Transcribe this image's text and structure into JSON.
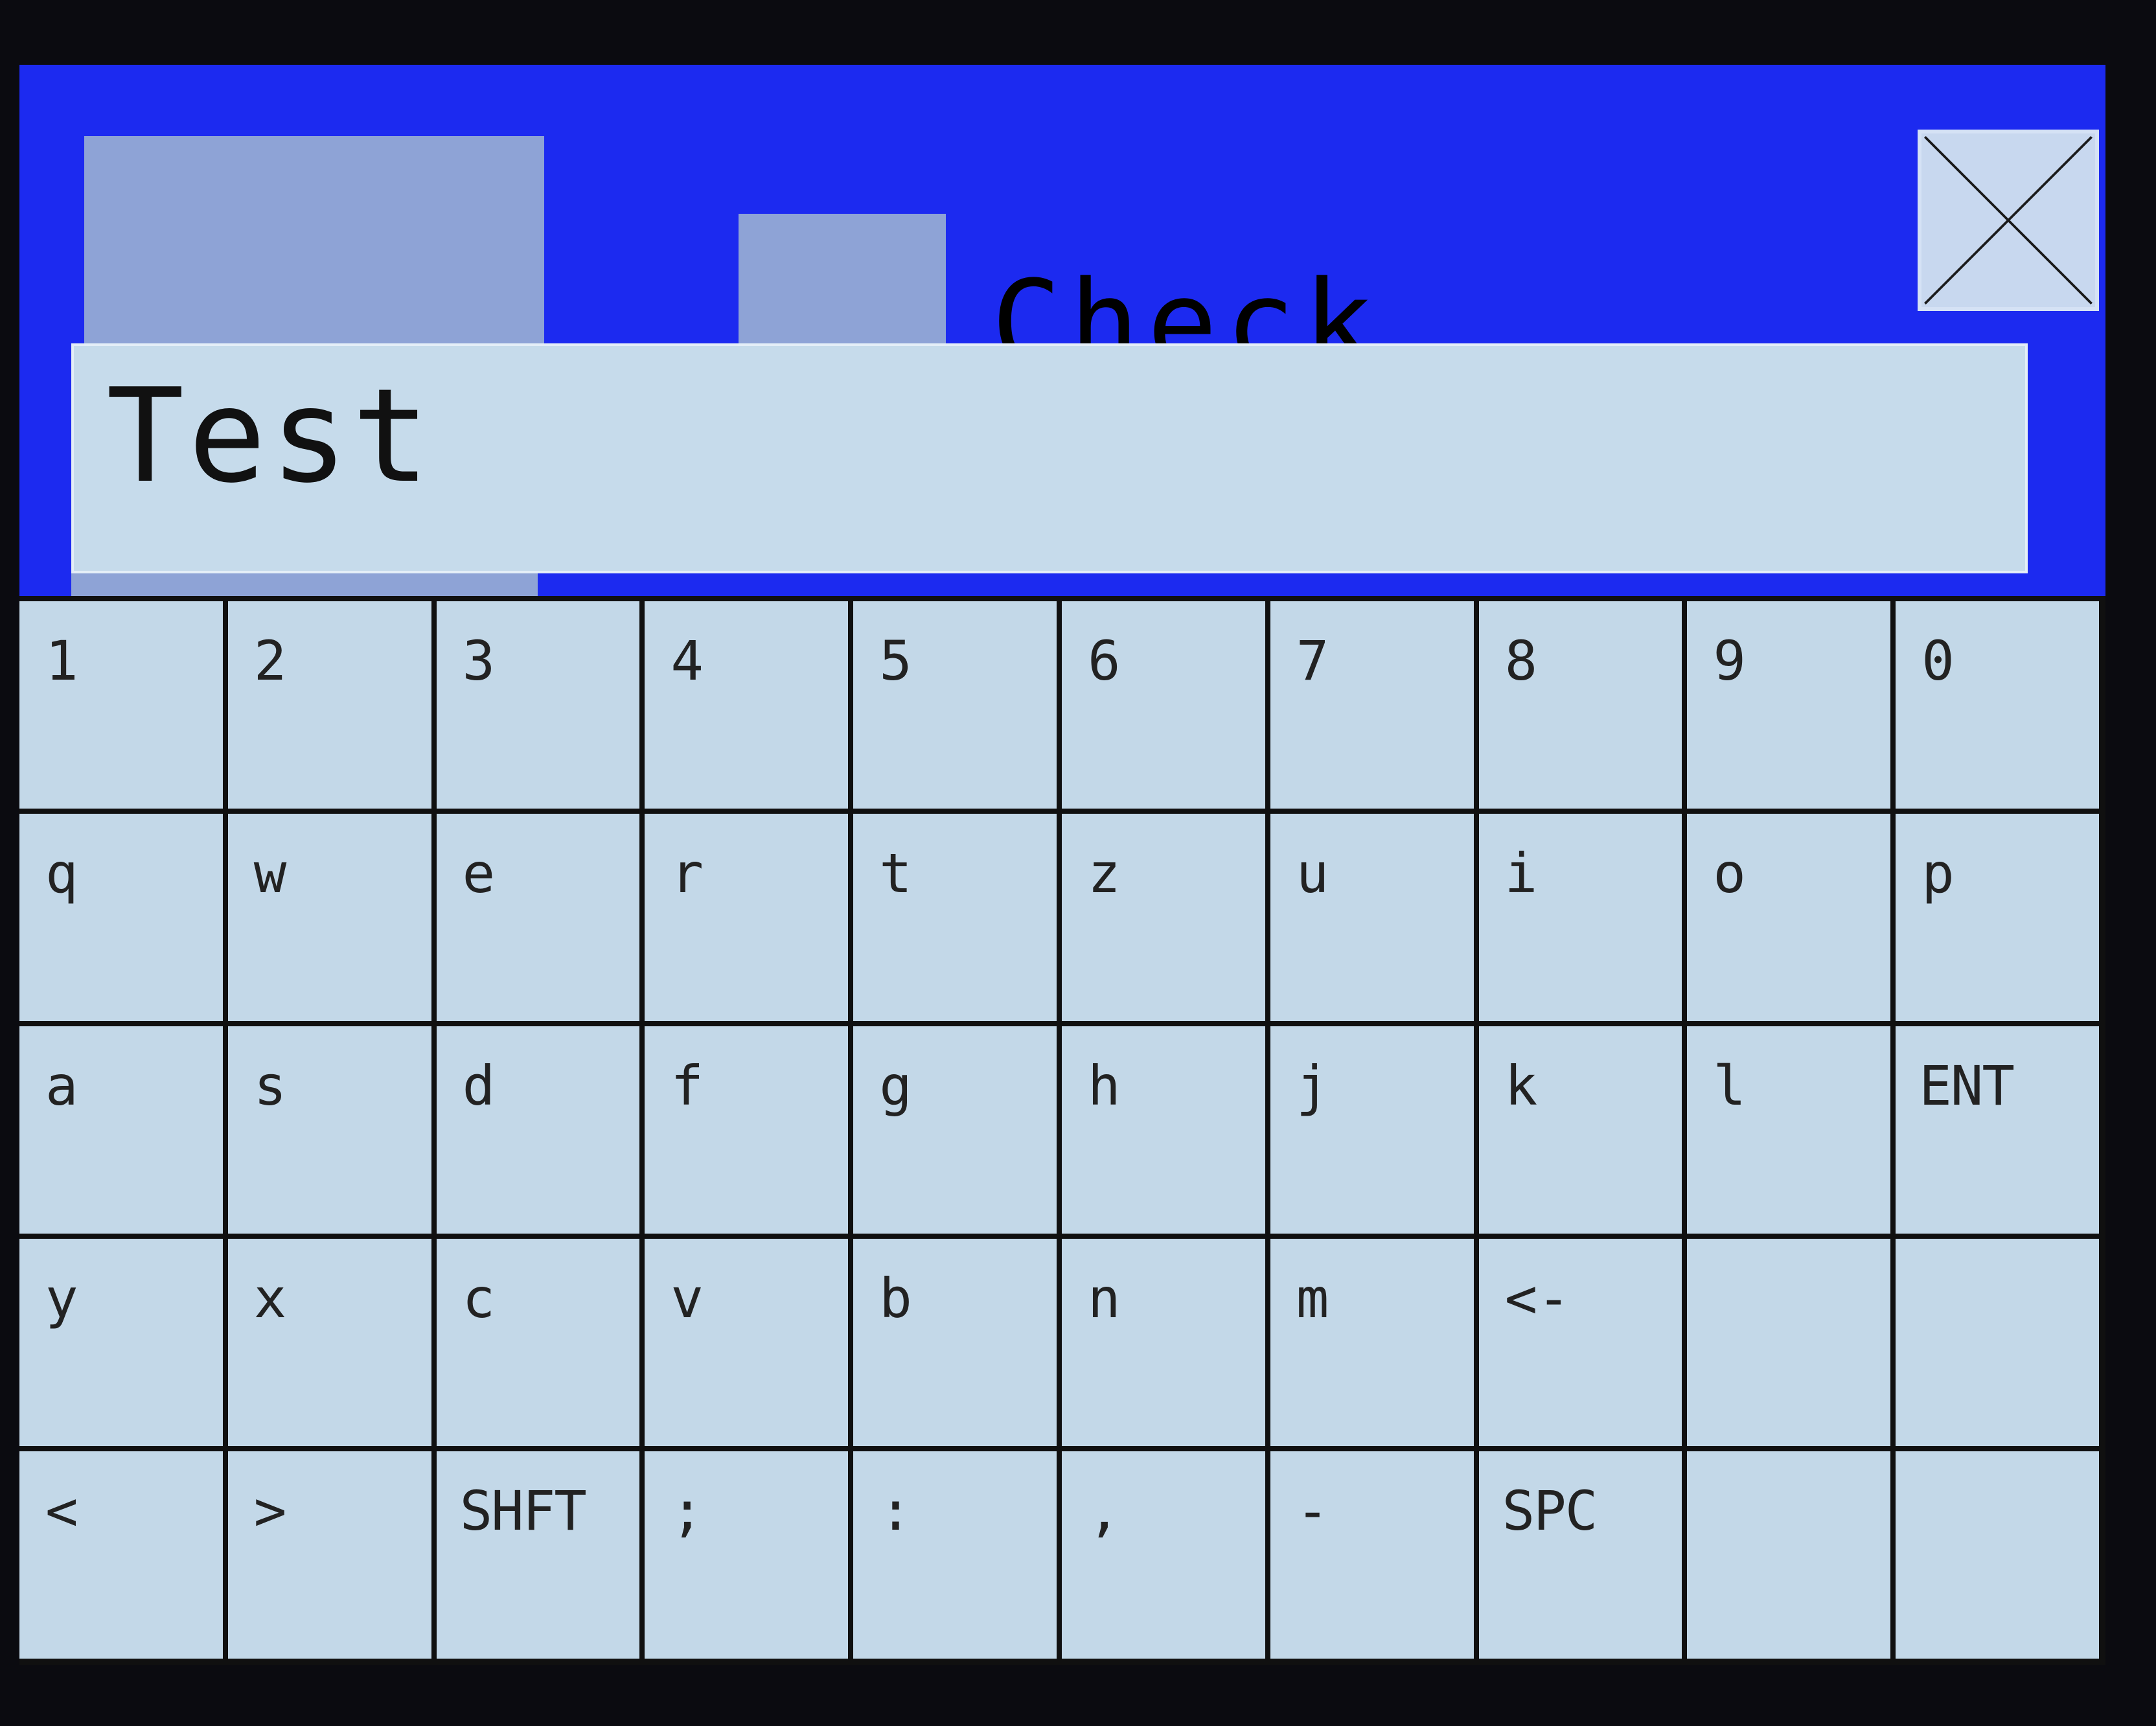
{
  "window": {
    "check_label": "Check",
    "close_icon": "close-x-icon"
  },
  "input": {
    "value": "Test"
  },
  "keyboard": {
    "rows": [
      [
        "1",
        "2",
        "3",
        "4",
        "5",
        "6",
        "7",
        "8",
        "9",
        "0"
      ],
      [
        "q",
        "w",
        "e",
        "r",
        "t",
        "z",
        "u",
        "i",
        "o",
        "p"
      ],
      [
        "a",
        "s",
        "d",
        "f",
        "g",
        "h",
        "j",
        "k",
        "l",
        "ENT"
      ],
      [
        "y",
        "x",
        "c",
        "v",
        "b",
        "n",
        "m",
        "<-",
        "",
        ""
      ],
      [
        "<",
        ">",
        "SHFT",
        ";",
        ":",
        ",",
        "-",
        "SPC",
        "",
        ""
      ]
    ]
  },
  "colors": {
    "background": "#1c2af0",
    "key": "#c3d8e8",
    "panel": "#8ea3d6",
    "grid_lines": "#101010"
  }
}
